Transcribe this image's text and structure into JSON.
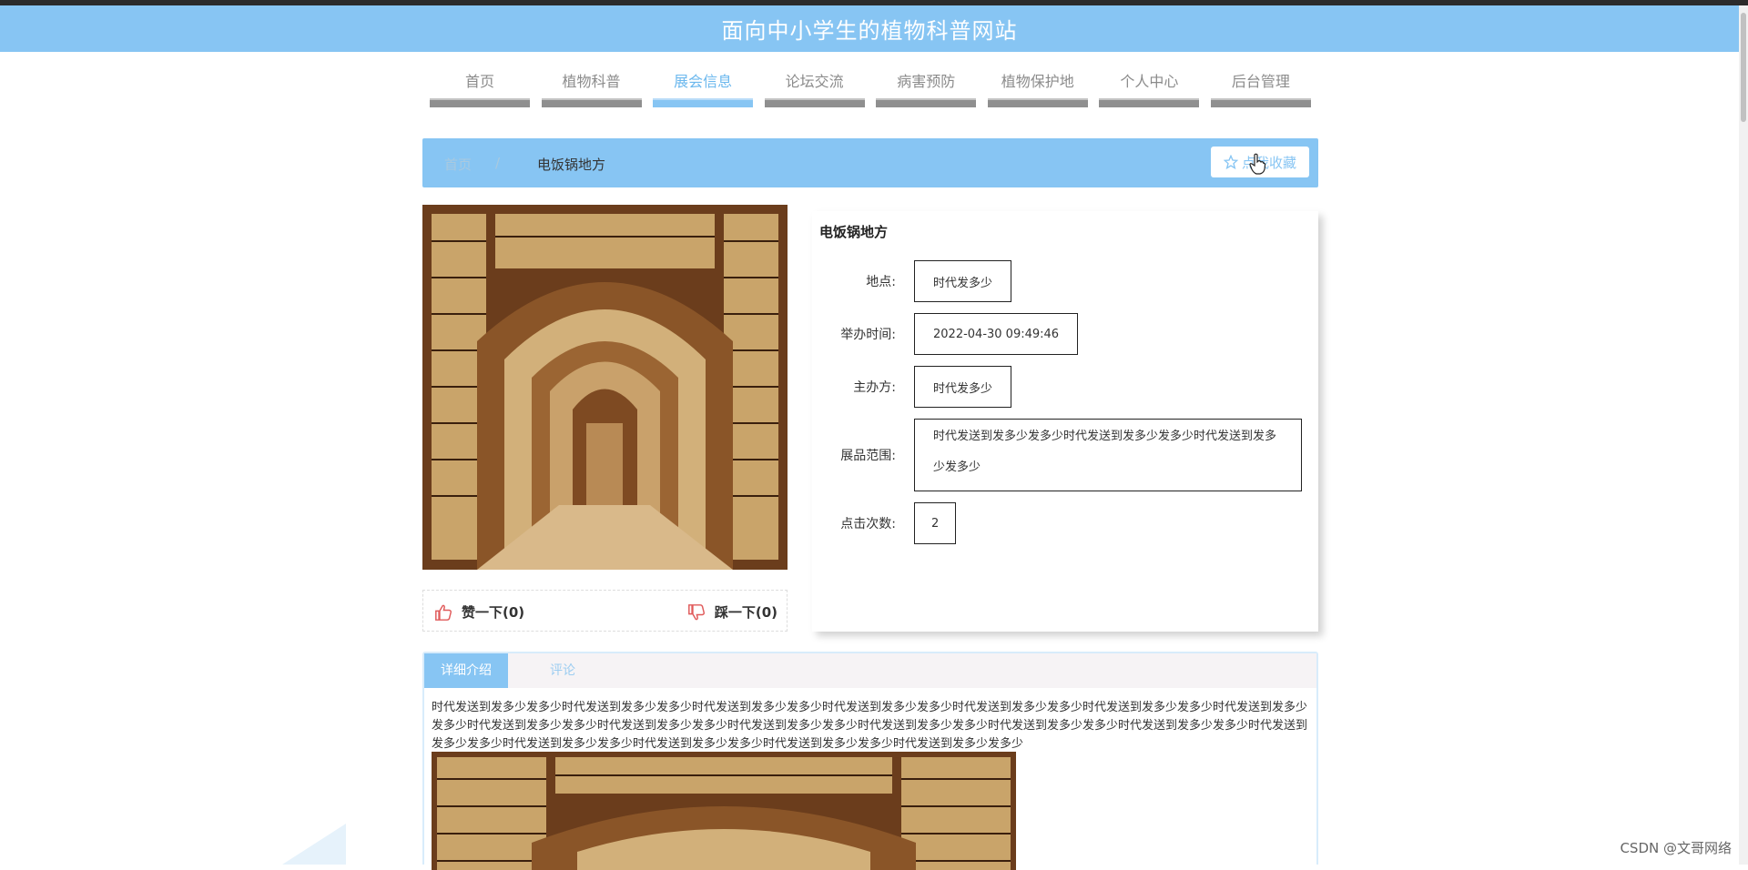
{
  "header": {
    "title": "面向中小学生的植物科普网站"
  },
  "nav": {
    "items": [
      {
        "label": "首页",
        "active": false
      },
      {
        "label": "植物科普",
        "active": false
      },
      {
        "label": "展会信息",
        "active": true
      },
      {
        "label": "论坛交流",
        "active": false
      },
      {
        "label": "病害预防",
        "active": false
      },
      {
        "label": "植物保护地",
        "active": false
      },
      {
        "label": "个人中心",
        "active": false
      },
      {
        "label": "后台管理",
        "active": false
      }
    ]
  },
  "breadcrumb": {
    "home": "首页",
    "separator": "/",
    "current": "电饭锅地方",
    "favorite_label": "点我收藏"
  },
  "detail": {
    "title": "电饭锅地方",
    "fields": [
      {
        "label": "地点:",
        "value": "时代发多少"
      },
      {
        "label": "举办时间:",
        "value": "2022-04-30 09:49:46"
      },
      {
        "label": "主办方:",
        "value": "时代发多少"
      },
      {
        "label": "展品范围:",
        "value": "时代发送到发多少发多少时代发送到发多少发多少时代发送到发多少发多少"
      },
      {
        "label": "点击次数:",
        "value": "2"
      }
    ]
  },
  "votes": {
    "like_label": "赞一下(0)",
    "dislike_label": "踩一下(0)"
  },
  "tabs": {
    "items": [
      "详细介绍",
      "评论"
    ],
    "active_index": 0,
    "content": "时代发送到发多少发多少时代发送到发多少发多少时代发送到发多少发多少时代发送到发多少发多少时代发送到发多少发多少时代发送到发多少发多少时代发送到发多少发多少时代发送到发多少发多少时代发送到发多少发多少时代发送到发多少发多少时代发送到发多少发多少时代发送到发多少发多少时代发送到发多少发多少时代发送到发多少发多少时代发送到发多少发多少时代发送到发多少发多少时代发送到发多少发多少时代发送到发多少发多少"
  },
  "watermark": "CSDN @文哥网络",
  "colors": {
    "accent": "#87c5f3",
    "nav_bar": "#8f8f8f",
    "like_icon": "#e05a5a"
  }
}
